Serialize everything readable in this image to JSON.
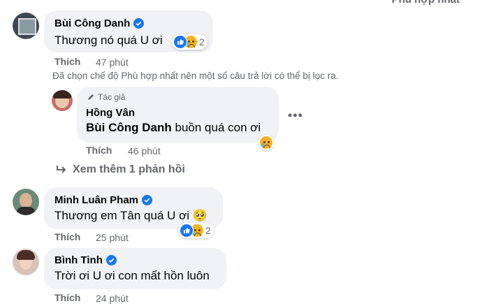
{
  "sort_label": "Phù hợp nhất",
  "like_label": "Thích",
  "filter_notice": "Đã chọn chế độ Phù hợp nhất nên một số câu trả lời có thể bị lọc ra.",
  "view_more": "Xem thêm 1 phản hồi",
  "comments": [
    {
      "author": "Bùi Công Danh",
      "text": "Thương nó quá U ơi",
      "time": "47 phút",
      "reaction_count": "2",
      "verified": true
    },
    {
      "author": "Minh Luân Pham",
      "text": "Thương em Tân quá U ơi 🥺",
      "time": "25 phút",
      "reaction_count": "2",
      "verified": true
    },
    {
      "author": "Bình Tinh",
      "text": "Trời ơi U ơi con mất hồn luôn",
      "time": "24 phút",
      "verified": true
    }
  ],
  "reply": {
    "badge": "Tác giả",
    "author": "Hồng Vân",
    "mention": "Bùi Công Danh",
    "text": " buồn quá con ơi",
    "time": "46 phút"
  },
  "colors": {
    "bubble": "#f0f2f5",
    "accent": "#1877f2",
    "muted": "#65676b"
  }
}
